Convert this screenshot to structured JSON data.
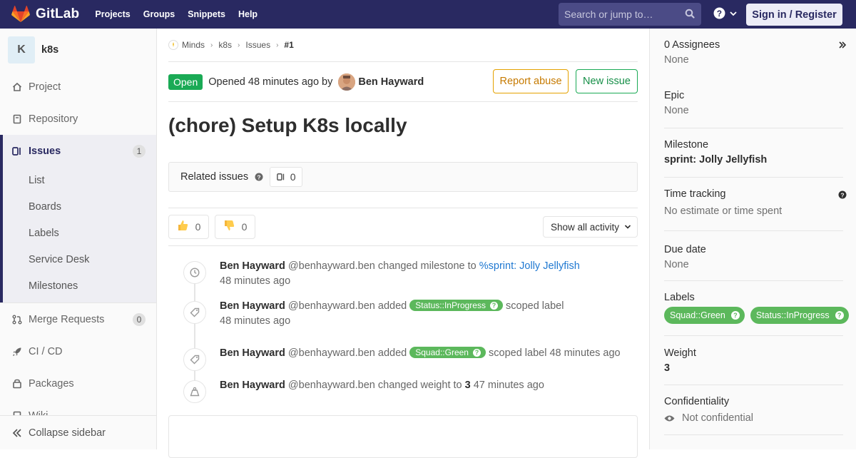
{
  "navbar": {
    "brand": "GitLab",
    "links": [
      "Projects",
      "Groups",
      "Snippets",
      "Help"
    ],
    "search_placeholder": "Search or jump to…",
    "signin": "Sign in / Register"
  },
  "sidebar": {
    "project_initial": "K",
    "project_name": "k8s",
    "items": {
      "project": "Project",
      "repository": "Repository",
      "issues": "Issues",
      "issues_count": "1",
      "merge_requests": "Merge Requests",
      "mr_count": "0",
      "cicd": "CI / CD",
      "packages": "Packages",
      "wiki": "Wiki"
    },
    "sub_items": [
      "List",
      "Boards",
      "Labels",
      "Service Desk",
      "Milestones"
    ],
    "collapse": "Collapse sidebar"
  },
  "breadcrumb": [
    "Minds",
    "k8s",
    "Issues",
    "#1"
  ],
  "issue": {
    "status": "Open",
    "opened_text": "Opened 48 minutes ago by",
    "author": "Ben Hayward",
    "report_abuse": "Report abuse",
    "new_issue": "New issue",
    "title": "(chore) Setup K8s locally"
  },
  "related": {
    "label": "Related issues",
    "count": "0"
  },
  "awards": {
    "thumbsup": "0",
    "thumbsdown": "0",
    "filter": "Show all activity"
  },
  "notes": [
    {
      "author": "Ben Hayward",
      "username": "@benhayward.ben",
      "action": "changed milestone to",
      "link": "%sprint: Jolly Jellyfish",
      "time": "48 minutes ago"
    },
    {
      "author": "Ben Hayward",
      "username": "@benhayward.ben",
      "action": "added",
      "label": "Status::InProgress",
      "suffix": "scoped label",
      "time": "48 minutes ago"
    },
    {
      "author": "Ben Hayward",
      "username": "@benhayward.ben",
      "action": "added",
      "label": "Squad::Green",
      "suffix": "scoped label 48 minutes ago"
    },
    {
      "author": "Ben Hayward",
      "username": "@benhayward.ben",
      "action": "changed weight to",
      "value": "3",
      "suffix": "47 minutes ago"
    }
  ],
  "right_sidebar": {
    "assignees_title": "0 Assignees",
    "assignees_value": "None",
    "epic_title": "Epic",
    "epic_value": "None",
    "milestone_title": "Milestone",
    "milestone_value": "sprint: Jolly Jellyfish",
    "time_title": "Time tracking",
    "time_value": "No estimate or time spent",
    "due_title": "Due date",
    "due_value": "None",
    "labels_title": "Labels",
    "labels": [
      "Squad::Green",
      "Status::InProgress"
    ],
    "weight_title": "Weight",
    "weight_value": "3",
    "conf_title": "Confidentiality",
    "conf_value": "Not confidential"
  },
  "colors": {
    "navbar": "#292961",
    "open_badge": "#1aaa55",
    "label_green": "#5cb85c",
    "link": "#1f78d1",
    "abuse": "#e4a100"
  }
}
